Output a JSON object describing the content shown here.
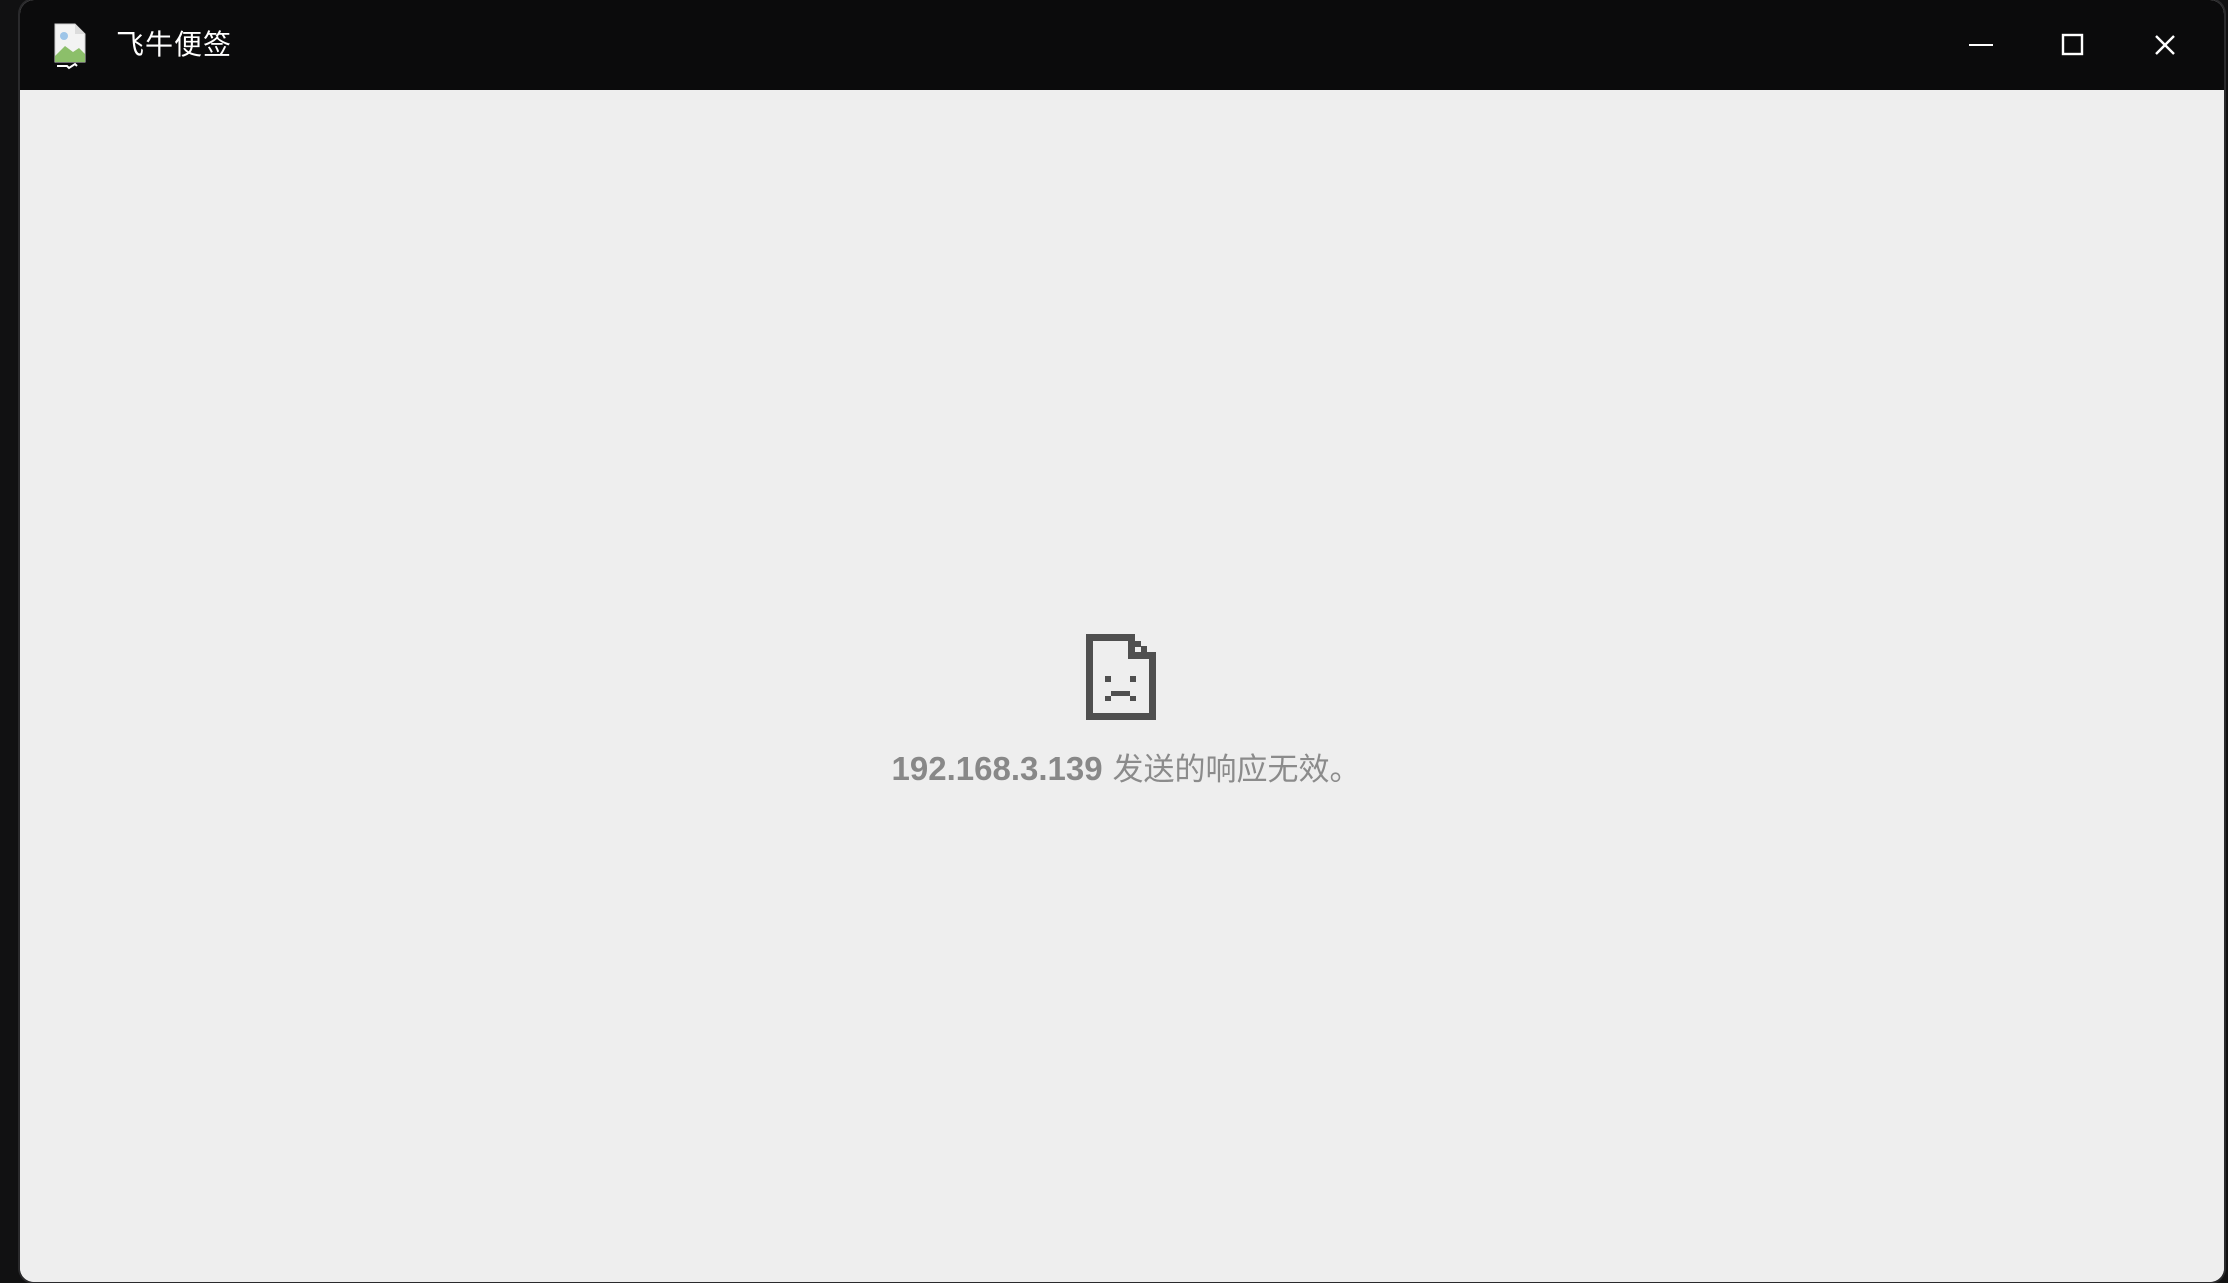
{
  "window": {
    "title": "飞牛便签",
    "app_icon": "broken-image-icon"
  },
  "controls": {
    "minimize_icon": "minimize-icon",
    "maximize_icon": "maximize-icon",
    "close_icon": "close-icon"
  },
  "error": {
    "icon": "sad-document-icon",
    "host": "192.168.3.139",
    "message": " 发送的响应无效。"
  },
  "colors": {
    "titlebar_bg": "#0b0b0c",
    "content_bg": "#eeeeee",
    "error_text": "#8b8b8b",
    "icon_color": "#4f4f4f"
  }
}
